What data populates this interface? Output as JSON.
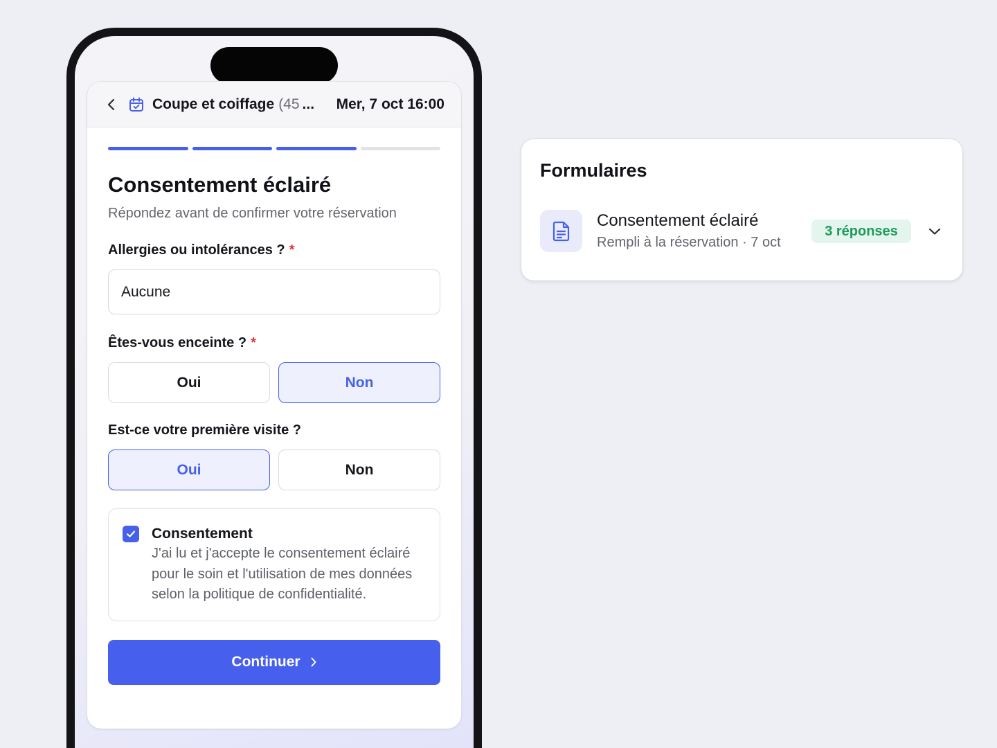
{
  "header": {
    "service_name": "Coupe et coiffage",
    "service_duration": "(45",
    "ellipsis": "...",
    "date_time": "Mer, 7 oct 16:00"
  },
  "progress": {
    "completed_steps": 3,
    "total_steps": 4
  },
  "form": {
    "title": "Consentement éclairé",
    "subtitle": "Répondez avant de confirmer votre réservation",
    "required_mark": "*",
    "q1": {
      "label": "Allergies ou intolérances ?",
      "required": true,
      "value": "Aucune"
    },
    "q2": {
      "label": "Êtes-vous enceinte ?",
      "required": true,
      "options": [
        "Oui",
        "Non"
      ],
      "selected": "Non"
    },
    "q3": {
      "label": "Est-ce votre première visite ?",
      "required": false,
      "options": [
        "Oui",
        "Non"
      ],
      "selected": "Oui"
    },
    "consent": {
      "title": "Consentement",
      "text": "J'ai lu et j'accepte le consentement éclairé pour le soin et l'utilisation de mes données selon la politique de confidentialité.",
      "checked": true
    },
    "continue_label": "Continuer"
  },
  "panel": {
    "title": "Formulaires",
    "item": {
      "name": "Consentement éclairé",
      "subtitle": "Rempli à la réservation · 7 oct",
      "badge": "3 réponses"
    }
  },
  "colors": {
    "accent": "#465fec",
    "selected_bg": "#eef1fd",
    "required": "#e03434",
    "badge_bg": "#e3f5ec",
    "badge_text": "#1f9a5b"
  },
  "icons": {
    "back": "chevron-left-icon",
    "calendar": "calendar-check-icon",
    "check": "check-icon",
    "continue": "chevron-right-icon",
    "document": "document-icon",
    "expand": "chevron-down-icon"
  }
}
